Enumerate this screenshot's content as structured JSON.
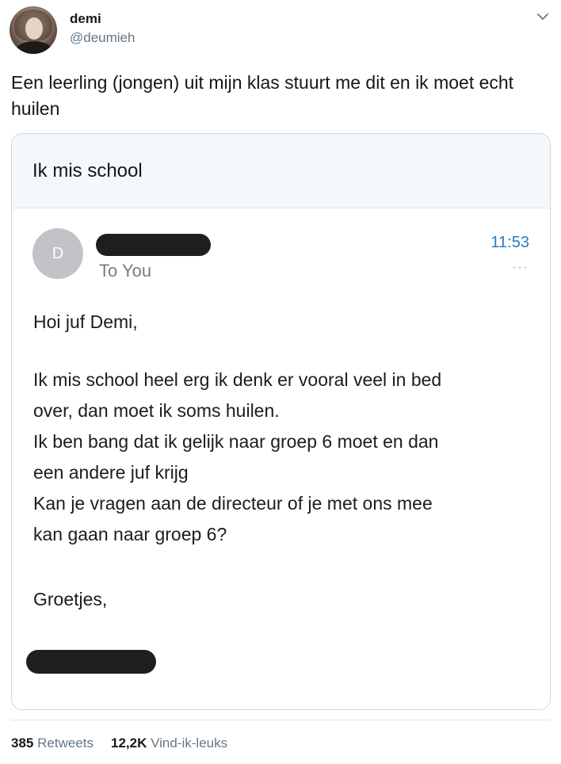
{
  "user": {
    "name": "demi",
    "handle": "@deumieh"
  },
  "tweet": {
    "text": "Een leerling (jongen) uit mijn klas stuurt me dit en ik moet echt huilen"
  },
  "card": {
    "subject": "Ik mis school",
    "sender_initial": "D",
    "recipient": "To You",
    "time": "11:53",
    "more": "···",
    "greeting": "Hoi juf Demi,",
    "message_lines": [
      "Ik mis school heel erg ik denk er vooral veel in bed",
      "over, dan moet ik soms huilen.",
      "Ik ben bang dat ik gelijk naar groep 6 moet en dan",
      "een andere juf krijg",
      "Kan je vragen aan de directeur of je met ons mee",
      "kan gaan naar groep 6?"
    ],
    "signoff": "Groetjes,"
  },
  "stats": {
    "retweets_count": "385",
    "retweets_label": "Retweets",
    "likes_count": "12,2K",
    "likes_label": "Vind-ik-leuks"
  },
  "icons": {
    "menu": "chevron-down-icon"
  }
}
